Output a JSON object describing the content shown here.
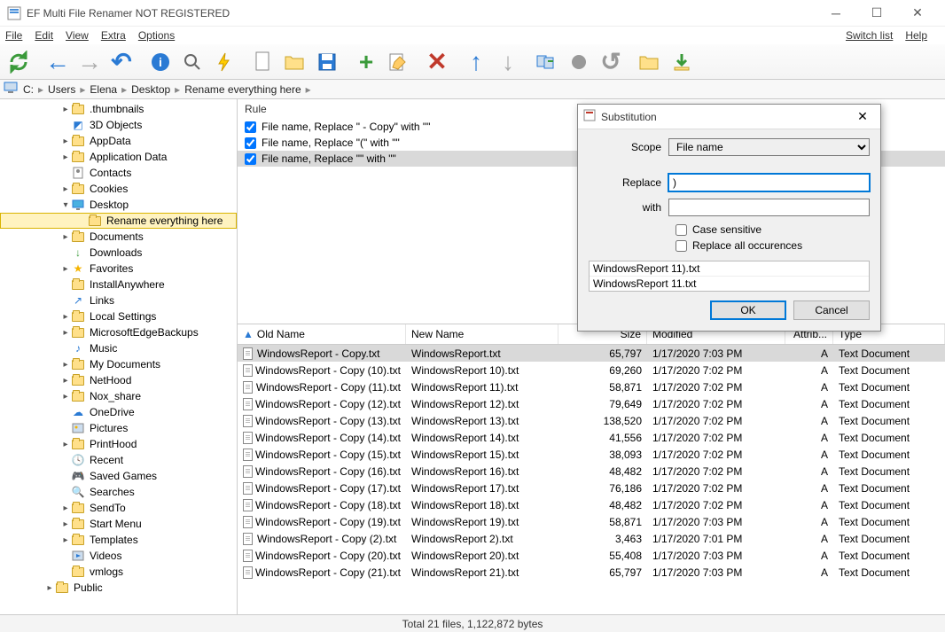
{
  "window": {
    "title": "EF Multi File Renamer NOT REGISTERED"
  },
  "menu": {
    "file": "File",
    "edit": "Edit",
    "view": "View",
    "extra": "Extra",
    "options": "Options",
    "switch_list": "Switch list",
    "help": "Help"
  },
  "breadcrumb": [
    "C:",
    "Users",
    "Elena",
    "Desktop",
    "Rename everything here"
  ],
  "tree": [
    {
      "label": ".thumbnails",
      "icon": "folder",
      "indent": 1,
      "twisty": "▸"
    },
    {
      "label": "3D Objects",
      "icon": "3d",
      "indent": 1
    },
    {
      "label": "AppData",
      "icon": "folder",
      "indent": 1,
      "twisty": "▸"
    },
    {
      "label": "Application Data",
      "icon": "folder",
      "indent": 1,
      "twisty": "▸"
    },
    {
      "label": "Contacts",
      "icon": "contacts",
      "indent": 1
    },
    {
      "label": "Cookies",
      "icon": "folder",
      "indent": 1,
      "twisty": "▸"
    },
    {
      "label": "Desktop",
      "icon": "desktop",
      "indent": 1,
      "twisty": "▾"
    },
    {
      "label": "Rename everything here",
      "icon": "folder-open",
      "indent": 2,
      "selected": true
    },
    {
      "label": "Documents",
      "icon": "folder",
      "indent": 1,
      "twisty": "▸"
    },
    {
      "label": "Downloads",
      "icon": "downloads",
      "indent": 1
    },
    {
      "label": "Favorites",
      "icon": "star",
      "indent": 1,
      "twisty": "▸"
    },
    {
      "label": "InstallAnywhere",
      "icon": "folder",
      "indent": 1
    },
    {
      "label": "Links",
      "icon": "links",
      "indent": 1
    },
    {
      "label": "Local Settings",
      "icon": "folder",
      "indent": 1,
      "twisty": "▸"
    },
    {
      "label": "MicrosoftEdgeBackups",
      "icon": "folder",
      "indent": 1,
      "twisty": "▸"
    },
    {
      "label": "Music",
      "icon": "music",
      "indent": 1
    },
    {
      "label": "My Documents",
      "icon": "folder",
      "indent": 1,
      "twisty": "▸"
    },
    {
      "label": "NetHood",
      "icon": "folder",
      "indent": 1,
      "twisty": "▸"
    },
    {
      "label": "Nox_share",
      "icon": "folder",
      "indent": 1,
      "twisty": "▸"
    },
    {
      "label": "OneDrive",
      "icon": "onedrive",
      "indent": 1
    },
    {
      "label": "Pictures",
      "icon": "pictures",
      "indent": 1
    },
    {
      "label": "PrintHood",
      "icon": "folder",
      "indent": 1,
      "twisty": "▸"
    },
    {
      "label": "Recent",
      "icon": "recent",
      "indent": 1
    },
    {
      "label": "Saved Games",
      "icon": "games",
      "indent": 1
    },
    {
      "label": "Searches",
      "icon": "search",
      "indent": 1
    },
    {
      "label": "SendTo",
      "icon": "folder",
      "indent": 1,
      "twisty": "▸"
    },
    {
      "label": "Start Menu",
      "icon": "folder",
      "indent": 1,
      "twisty": "▸"
    },
    {
      "label": "Templates",
      "icon": "folder",
      "indent": 1,
      "twisty": "▸"
    },
    {
      "label": "Videos",
      "icon": "videos",
      "indent": 1
    },
    {
      "label": "vmlogs",
      "icon": "folder",
      "indent": 1
    },
    {
      "label": "Public",
      "icon": "folder",
      "indent": 0,
      "twisty": "▸"
    }
  ],
  "rule_panel": {
    "heading": "Rule",
    "rules": [
      {
        "text": "File name, Replace \" - Copy\" with \"\"",
        "checked": true
      },
      {
        "text": "File name, Replace \"(\" with \"\"",
        "checked": true
      },
      {
        "text": "File name, Replace \"\" with \"\"",
        "checked": true,
        "selected": true
      }
    ]
  },
  "filelist": {
    "columns": {
      "old_name": "Old Name",
      "new_name": "New Name",
      "size": "Size",
      "modified": "Modified",
      "attrib": "Attrib...",
      "type": "Type"
    },
    "rows": [
      {
        "old": "WindowsReport - Copy.txt",
        "new": "WindowsReport.txt",
        "size": "65,797",
        "mod": "1/17/2020 7:03 PM",
        "attr": "A",
        "type": "Text Document",
        "selected": true
      },
      {
        "old": "WindowsReport - Copy (10).txt",
        "new": "WindowsReport 10).txt",
        "size": "69,260",
        "mod": "1/17/2020 7:02 PM",
        "attr": "A",
        "type": "Text Document"
      },
      {
        "old": "WindowsReport - Copy (11).txt",
        "new": "WindowsReport 11).txt",
        "size": "58,871",
        "mod": "1/17/2020 7:02 PM",
        "attr": "A",
        "type": "Text Document"
      },
      {
        "old": "WindowsReport - Copy (12).txt",
        "new": "WindowsReport 12).txt",
        "size": "79,649",
        "mod": "1/17/2020 7:02 PM",
        "attr": "A",
        "type": "Text Document"
      },
      {
        "old": "WindowsReport - Copy (13).txt",
        "new": "WindowsReport 13).txt",
        "size": "138,520",
        "mod": "1/17/2020 7:02 PM",
        "attr": "A",
        "type": "Text Document"
      },
      {
        "old": "WindowsReport - Copy (14).txt",
        "new": "WindowsReport 14).txt",
        "size": "41,556",
        "mod": "1/17/2020 7:02 PM",
        "attr": "A",
        "type": "Text Document"
      },
      {
        "old": "WindowsReport - Copy (15).txt",
        "new": "WindowsReport 15).txt",
        "size": "38,093",
        "mod": "1/17/2020 7:02 PM",
        "attr": "A",
        "type": "Text Document"
      },
      {
        "old": "WindowsReport - Copy (16).txt",
        "new": "WindowsReport 16).txt",
        "size": "48,482",
        "mod": "1/17/2020 7:02 PM",
        "attr": "A",
        "type": "Text Document"
      },
      {
        "old": "WindowsReport - Copy (17).txt",
        "new": "WindowsReport 17).txt",
        "size": "76,186",
        "mod": "1/17/2020 7:02 PM",
        "attr": "A",
        "type": "Text Document"
      },
      {
        "old": "WindowsReport - Copy (18).txt",
        "new": "WindowsReport 18).txt",
        "size": "48,482",
        "mod": "1/17/2020 7:02 PM",
        "attr": "A",
        "type": "Text Document"
      },
      {
        "old": "WindowsReport - Copy (19).txt",
        "new": "WindowsReport 19).txt",
        "size": "58,871",
        "mod": "1/17/2020 7:03 PM",
        "attr": "A",
        "type": "Text Document"
      },
      {
        "old": "WindowsReport - Copy (2).txt",
        "new": "WindowsReport 2).txt",
        "size": "3,463",
        "mod": "1/17/2020 7:01 PM",
        "attr": "A",
        "type": "Text Document"
      },
      {
        "old": "WindowsReport - Copy (20).txt",
        "new": "WindowsReport 20).txt",
        "size": "55,408",
        "mod": "1/17/2020 7:03 PM",
        "attr": "A",
        "type": "Text Document"
      },
      {
        "old": "WindowsReport - Copy (21).txt",
        "new": "WindowsReport 21).txt",
        "size": "65,797",
        "mod": "1/17/2020 7:03 PM",
        "attr": "A",
        "type": "Text Document"
      }
    ]
  },
  "statusbar": "Total 21 files, 1,122,872 bytes",
  "dialog": {
    "title": "Substitution",
    "scope_label": "Scope",
    "scope_value": "File name",
    "replace_label": "Replace",
    "replace_value": ")",
    "with_label": "with",
    "with_value": "",
    "case_sensitive": "Case sensitive",
    "replace_all": "Replace all occurences",
    "preview_before": "WindowsReport 11).txt",
    "preview_after": "WindowsReport 11.txt",
    "ok": "OK",
    "cancel": "Cancel"
  }
}
